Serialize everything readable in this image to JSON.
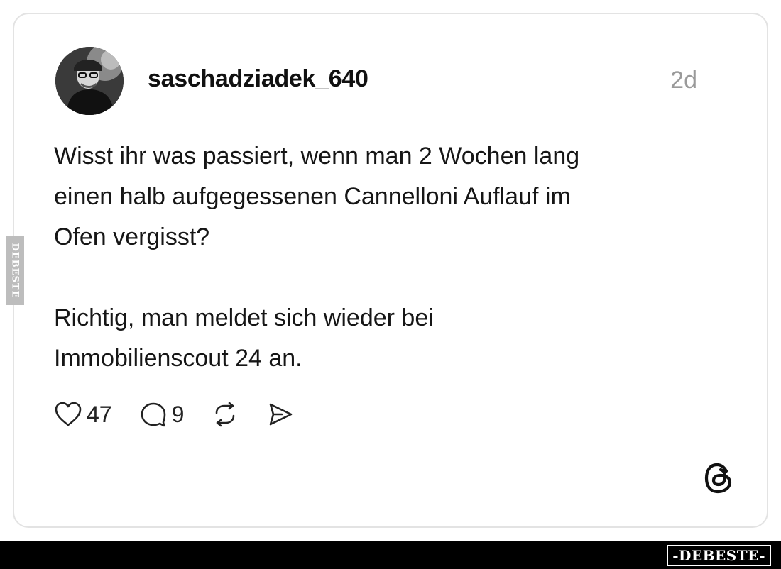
{
  "post": {
    "username": "saschadziadek_640",
    "timestamp": "2d",
    "text_lines_p1": [
      "Wisst ihr was passiert, wenn man 2 Wochen lang",
      "einen halb aufgegessenen Cannelloni Auflauf im",
      "Ofen vergisst?"
    ],
    "text_lines_p2": [
      "Richtig, man meldet sich wieder bei",
      "Immobilienscout 24 an."
    ],
    "likes": "47",
    "comments": "9"
  },
  "icons": {
    "like": "heart-icon",
    "comment": "comment-bubble-icon",
    "repost": "repost-icon",
    "share": "send-icon",
    "brand": "threads-logo-icon"
  },
  "watermark": {
    "side": "DEBESTE",
    "bottom": "-DEBESTE-"
  },
  "colors": {
    "text": "#161616",
    "muted": "#9a9a9a",
    "border": "#e3e3e3",
    "bar": "#000000"
  }
}
